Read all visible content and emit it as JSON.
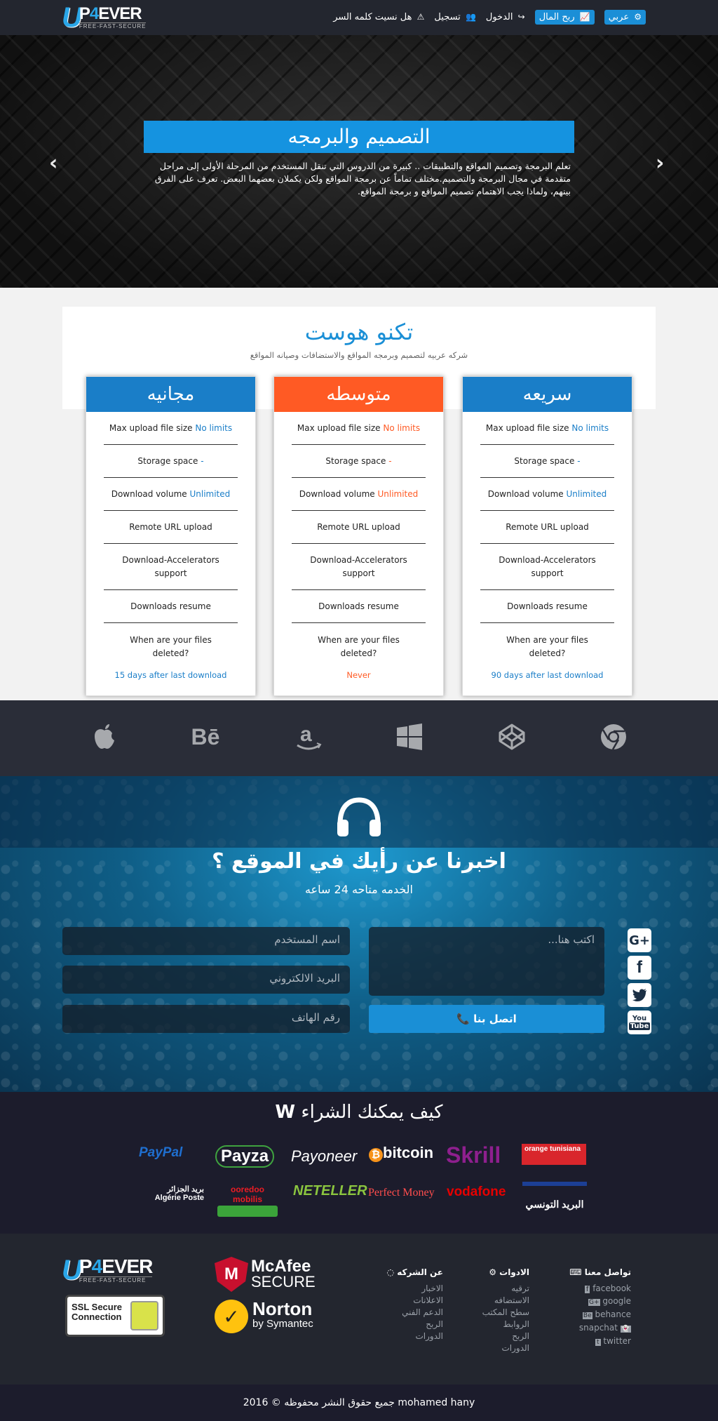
{
  "navbar": {
    "logo": {
      "u": "U",
      "p": "P",
      "four": "4",
      "ever": "EVER",
      "tagline": "FREE-FAST-SECURE"
    },
    "language": "عربي",
    "earn": "ربح المال",
    "login": "الدخول",
    "register": "تسجيل",
    "forgot": "هل نسيت كلمه السر"
  },
  "hero": {
    "title": "التصميم والبرمجه",
    "description": "تعلم البرمجة وتصميم المواقع والتطبيقات .. كبيرة من الدروس التي تنقل المستخدم من المرحلة الأولى إلى مراحل متقدمة في مجال البرمجة والتصميم.مختلف تماماً عن برمجة المواقع ولكن يكملان بعضهما البعض. تعرف على الفرق بينهم، ولماذا يجب الاهتمام تصميم المواقع و برمجة المواقع."
  },
  "host": {
    "title": "تكنو هوست",
    "subtitle": "شركه عربيه لتصميم وبرمجه المواقع والاستضافات وصيانه المواقع"
  },
  "plans": [
    {
      "name": "مجانيه",
      "color": "#1a7ec8",
      "upload": {
        "label": "Max upload file size",
        "value": "No limits"
      },
      "storage": {
        "label": "Storage space",
        "value": "-"
      },
      "download": {
        "label": "Download volume",
        "value": "Unlimited"
      },
      "remote": "Remote URL upload",
      "accel": "Download-Accelerators support",
      "resume": "Downloads resume",
      "deleted": "When are your files deleted?",
      "deleted_value": "15 days after last download"
    },
    {
      "name": "متوسطه",
      "color": "#ff5a24",
      "upload": {
        "label": "Max upload file size",
        "value": "No limits"
      },
      "storage": {
        "label": "Storage space",
        "value": "-"
      },
      "download": {
        "label": "Download volume",
        "value": "Unlimited"
      },
      "remote": "Remote URL upload",
      "accel": "Download-Accelerators support",
      "resume": "Downloads resume",
      "deleted": "When are your files deleted?",
      "deleted_value": "Never"
    },
    {
      "name": "سريعه",
      "color": "#1a7ec8",
      "upload": {
        "label": "Max upload file size",
        "value": "No limits"
      },
      "storage": {
        "label": "Storage space",
        "value": "-"
      },
      "download": {
        "label": "Download volume",
        "value": "Unlimited"
      },
      "remote": "Remote URL upload",
      "accel": "Download-Accelerators support",
      "resume": "Downloads resume",
      "deleted": "When are your files deleted?",
      "deleted_value": "90 days after last download"
    }
  ],
  "brand_icons": [
    "apple-icon",
    "behance-icon",
    "amazon-icon",
    "windows-icon",
    "codepen-icon",
    "chrome-icon"
  ],
  "contact": {
    "title": "اخبرنا عن رأيك في الموقع ؟",
    "subtitle": "الخدمه متاحه 24 ساعه",
    "message_placeholder": "اكتب هنا...",
    "username_placeholder": "اسم المستخدم",
    "email_placeholder": "البريد الالكتروني",
    "phone_placeholder": "رقم الهاتف",
    "send": "اتصل بنا"
  },
  "social_icons": [
    "google-plus-icon",
    "facebook-icon",
    "twitter-icon",
    "youtube-icon"
  ],
  "payments": {
    "title": "كيف يمكنك الشراء",
    "row1": [
      "PayPal",
      "Payza",
      "Payoneer",
      "bitcoin",
      "Skrill",
      "orange tunisiana"
    ],
    "row2": [
      "بريد الجزائر Algérie Poste",
      "ooredoo mobilis",
      "NETELLER",
      "Perfect Money",
      "vodafone",
      "البريد التونسي"
    ]
  },
  "footer": {
    "badges": {
      "ssl": "SSL Secure Connection",
      "mcafee_top": "McAfee",
      "mcafee_bottom": "SECURE",
      "norton_top": "Norton",
      "norton_bottom": "by Symantec"
    },
    "about": {
      "title": "عن الشركه",
      "items": [
        "الاخبار",
        "الاعلانات",
        "الدعم الفني",
        "الربح",
        "الدورات"
      ]
    },
    "tools": {
      "title": "الادوات",
      "items": [
        "ترقيه",
        "الاستضافه",
        "سطح المكتب",
        "الروابط",
        "الربح",
        "الدورات"
      ]
    },
    "connect": {
      "title": "تواصل معنا",
      "items": [
        "facebook",
        "google",
        "behance",
        "snapchat",
        "twitter"
      ]
    }
  },
  "copyright": "جميع حقوق النشر محفوظه © 2016 mohamed hany"
}
